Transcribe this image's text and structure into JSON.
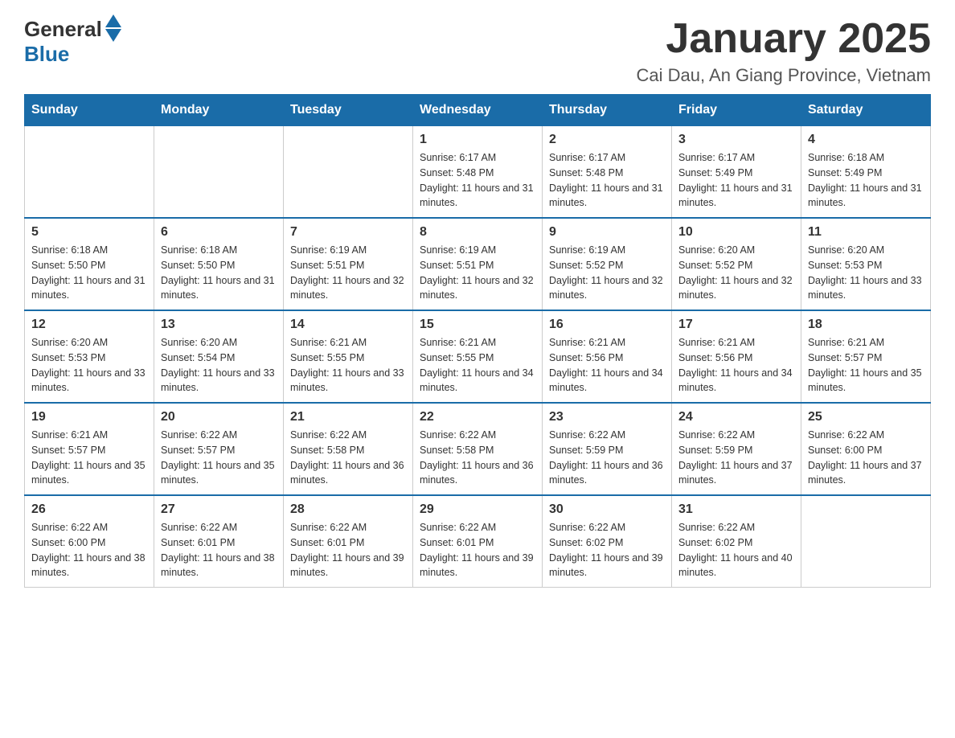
{
  "header": {
    "logo_general": "General",
    "logo_blue": "Blue",
    "title": "January 2025",
    "subtitle": "Cai Dau, An Giang Province, Vietnam"
  },
  "days_of_week": [
    "Sunday",
    "Monday",
    "Tuesday",
    "Wednesday",
    "Thursday",
    "Friday",
    "Saturday"
  ],
  "weeks": [
    {
      "days": [
        {
          "number": "",
          "info": ""
        },
        {
          "number": "",
          "info": ""
        },
        {
          "number": "",
          "info": ""
        },
        {
          "number": "1",
          "info": "Sunrise: 6:17 AM\nSunset: 5:48 PM\nDaylight: 11 hours and 31 minutes."
        },
        {
          "number": "2",
          "info": "Sunrise: 6:17 AM\nSunset: 5:48 PM\nDaylight: 11 hours and 31 minutes."
        },
        {
          "number": "3",
          "info": "Sunrise: 6:17 AM\nSunset: 5:49 PM\nDaylight: 11 hours and 31 minutes."
        },
        {
          "number": "4",
          "info": "Sunrise: 6:18 AM\nSunset: 5:49 PM\nDaylight: 11 hours and 31 minutes."
        }
      ]
    },
    {
      "days": [
        {
          "number": "5",
          "info": "Sunrise: 6:18 AM\nSunset: 5:50 PM\nDaylight: 11 hours and 31 minutes."
        },
        {
          "number": "6",
          "info": "Sunrise: 6:18 AM\nSunset: 5:50 PM\nDaylight: 11 hours and 31 minutes."
        },
        {
          "number": "7",
          "info": "Sunrise: 6:19 AM\nSunset: 5:51 PM\nDaylight: 11 hours and 32 minutes."
        },
        {
          "number": "8",
          "info": "Sunrise: 6:19 AM\nSunset: 5:51 PM\nDaylight: 11 hours and 32 minutes."
        },
        {
          "number": "9",
          "info": "Sunrise: 6:19 AM\nSunset: 5:52 PM\nDaylight: 11 hours and 32 minutes."
        },
        {
          "number": "10",
          "info": "Sunrise: 6:20 AM\nSunset: 5:52 PM\nDaylight: 11 hours and 32 minutes."
        },
        {
          "number": "11",
          "info": "Sunrise: 6:20 AM\nSunset: 5:53 PM\nDaylight: 11 hours and 33 minutes."
        }
      ]
    },
    {
      "days": [
        {
          "number": "12",
          "info": "Sunrise: 6:20 AM\nSunset: 5:53 PM\nDaylight: 11 hours and 33 minutes."
        },
        {
          "number": "13",
          "info": "Sunrise: 6:20 AM\nSunset: 5:54 PM\nDaylight: 11 hours and 33 minutes."
        },
        {
          "number": "14",
          "info": "Sunrise: 6:21 AM\nSunset: 5:55 PM\nDaylight: 11 hours and 33 minutes."
        },
        {
          "number": "15",
          "info": "Sunrise: 6:21 AM\nSunset: 5:55 PM\nDaylight: 11 hours and 34 minutes."
        },
        {
          "number": "16",
          "info": "Sunrise: 6:21 AM\nSunset: 5:56 PM\nDaylight: 11 hours and 34 minutes."
        },
        {
          "number": "17",
          "info": "Sunrise: 6:21 AM\nSunset: 5:56 PM\nDaylight: 11 hours and 34 minutes."
        },
        {
          "number": "18",
          "info": "Sunrise: 6:21 AM\nSunset: 5:57 PM\nDaylight: 11 hours and 35 minutes."
        }
      ]
    },
    {
      "days": [
        {
          "number": "19",
          "info": "Sunrise: 6:21 AM\nSunset: 5:57 PM\nDaylight: 11 hours and 35 minutes."
        },
        {
          "number": "20",
          "info": "Sunrise: 6:22 AM\nSunset: 5:57 PM\nDaylight: 11 hours and 35 minutes."
        },
        {
          "number": "21",
          "info": "Sunrise: 6:22 AM\nSunset: 5:58 PM\nDaylight: 11 hours and 36 minutes."
        },
        {
          "number": "22",
          "info": "Sunrise: 6:22 AM\nSunset: 5:58 PM\nDaylight: 11 hours and 36 minutes."
        },
        {
          "number": "23",
          "info": "Sunrise: 6:22 AM\nSunset: 5:59 PM\nDaylight: 11 hours and 36 minutes."
        },
        {
          "number": "24",
          "info": "Sunrise: 6:22 AM\nSunset: 5:59 PM\nDaylight: 11 hours and 37 minutes."
        },
        {
          "number": "25",
          "info": "Sunrise: 6:22 AM\nSunset: 6:00 PM\nDaylight: 11 hours and 37 minutes."
        }
      ]
    },
    {
      "days": [
        {
          "number": "26",
          "info": "Sunrise: 6:22 AM\nSunset: 6:00 PM\nDaylight: 11 hours and 38 minutes."
        },
        {
          "number": "27",
          "info": "Sunrise: 6:22 AM\nSunset: 6:01 PM\nDaylight: 11 hours and 38 minutes."
        },
        {
          "number": "28",
          "info": "Sunrise: 6:22 AM\nSunset: 6:01 PM\nDaylight: 11 hours and 39 minutes."
        },
        {
          "number": "29",
          "info": "Sunrise: 6:22 AM\nSunset: 6:01 PM\nDaylight: 11 hours and 39 minutes."
        },
        {
          "number": "30",
          "info": "Sunrise: 6:22 AM\nSunset: 6:02 PM\nDaylight: 11 hours and 39 minutes."
        },
        {
          "number": "31",
          "info": "Sunrise: 6:22 AM\nSunset: 6:02 PM\nDaylight: 11 hours and 40 minutes."
        },
        {
          "number": "",
          "info": ""
        }
      ]
    }
  ]
}
